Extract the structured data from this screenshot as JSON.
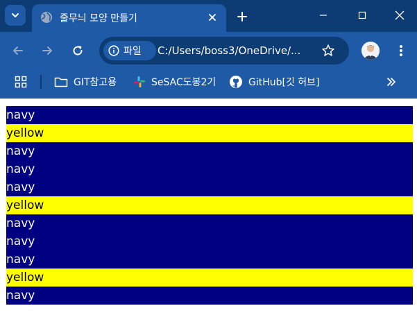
{
  "browser": {
    "tab": {
      "title": "줄무늬 모양 만들기"
    },
    "omnibox": {
      "site_chip_label": "파일",
      "url": "C:/Users/boss3/OneDrive/..."
    },
    "bookmarks": [
      {
        "label": "GIT참고용"
      },
      {
        "label": "SeSAC도봉2기"
      },
      {
        "label": "GitHub[깃 허브]"
      }
    ]
  },
  "colors": {
    "navy": "#000080",
    "yellow": "#ffff00"
  },
  "rows": [
    {
      "text": "navy"
    },
    {
      "text": "yellow"
    },
    {
      "text": "navy"
    },
    {
      "text": "navy"
    },
    {
      "text": "navy"
    },
    {
      "text": "yellow"
    },
    {
      "text": "navy"
    },
    {
      "text": "navy"
    },
    {
      "text": "navy"
    },
    {
      "text": "yellow"
    },
    {
      "text": "navy"
    }
  ]
}
